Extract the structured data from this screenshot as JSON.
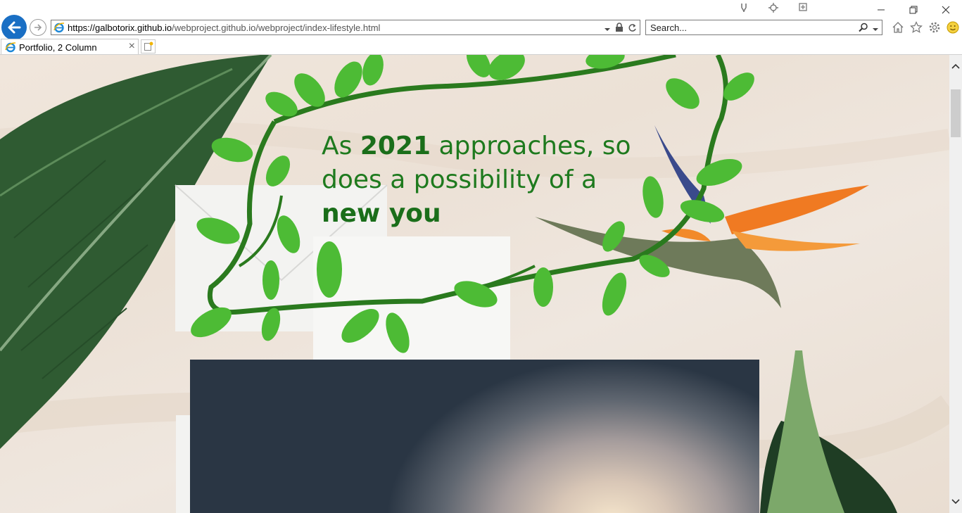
{
  "browser": {
    "url_host": "https://galbotorix.github.io",
    "url_path": "/webproject.github.io/webproject/index-lifestyle.html",
    "search_placeholder": "Search...",
    "tab_title": "Portfolio, 2 Column",
    "tab_close": "×"
  },
  "hero": {
    "line1_pre": "As ",
    "line1_bold": "2021",
    "line1_post": " approaches, so",
    "line2": "does a possibility of a",
    "line3_bold": "new you"
  },
  "colors": {
    "vine": "#2a7a1e",
    "leaf": "#4dbb35",
    "heading": "#1e7a1e"
  },
  "icons": [
    "back-arrow-icon",
    "forward-arrow-icon",
    "ie-logo-icon",
    "dropdown-icon",
    "lock-icon",
    "refresh-icon",
    "search-icon",
    "home-icon",
    "favorites-star-icon",
    "settings-gear-icon",
    "smiley-feedback-icon",
    "minimize-icon",
    "restore-icon",
    "close-icon",
    "new-tab-icon"
  ]
}
